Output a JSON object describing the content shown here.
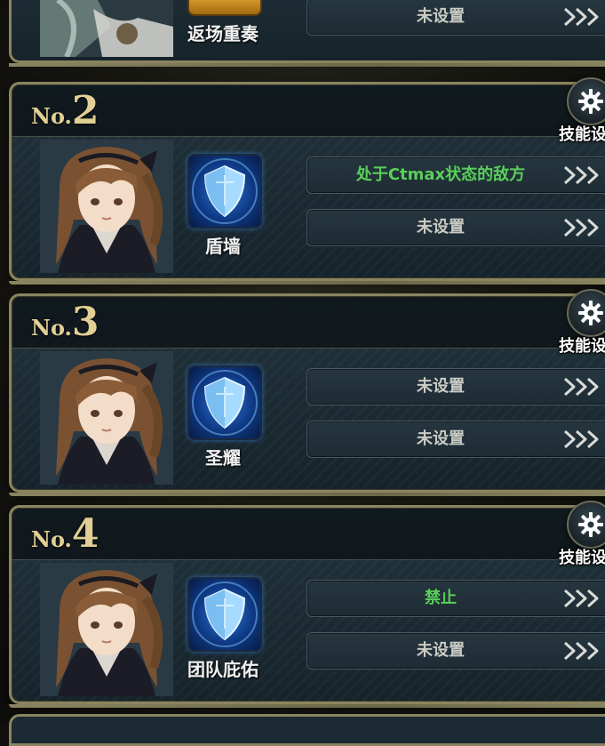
{
  "top_card": {
    "skill_name": "返场重奏",
    "slot_label": "未设置"
  },
  "skill_settings_label": "技能设置",
  "cards": [
    {
      "no_prefix": "No.",
      "number": "2",
      "skill_name": "盾墙",
      "slots": [
        {
          "label": "处于Ctmax状态的敌方",
          "color": "#59cf5b"
        },
        {
          "label": "未设置",
          "color": "#c9cbc4"
        }
      ]
    },
    {
      "no_prefix": "No.",
      "number": "3",
      "skill_name": "圣耀",
      "slots": [
        {
          "label": "未设置",
          "color": "#c9cbc4"
        },
        {
          "label": "未设置",
          "color": "#c9cbc4"
        }
      ]
    },
    {
      "no_prefix": "No.",
      "number": "4",
      "skill_name": "团队庇佑",
      "slots": [
        {
          "label": "禁止",
          "color": "#59cf5b"
        },
        {
          "label": "未设置",
          "color": "#c9cbc4"
        }
      ]
    }
  ],
  "colors": {
    "frame_gold": "#8a8460",
    "number_gold": "#e1cf95",
    "active_green": "#59cf5b",
    "inactive_text": "#c9cbc4"
  },
  "icons": {
    "settings": "gear-icon",
    "slot_action": "triple-chevron-right-icon",
    "skill": "shield-skill-icon"
  }
}
